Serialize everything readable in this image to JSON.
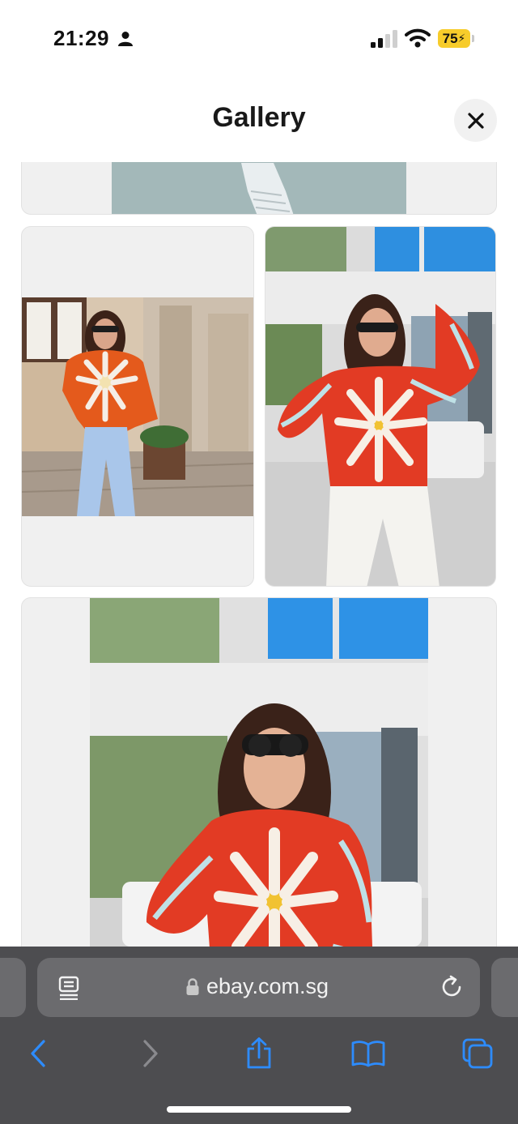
{
  "status_bar": {
    "time": "21:29",
    "battery_level": "75",
    "icons": [
      "person-icon",
      "signal-icon",
      "wifi-icon",
      "battery-icon"
    ]
  },
  "header": {
    "title": "Gallery",
    "close_icon": "close-icon"
  },
  "gallery": {
    "tiles": [
      {
        "id": "tile-top",
        "content": "photo-cropped"
      },
      {
        "id": "tile-left",
        "content": "photo"
      },
      {
        "id": "tile-right",
        "content": "photo"
      },
      {
        "id": "tile-big",
        "content": "photo"
      }
    ]
  },
  "browser": {
    "url": "ebay.com.sg",
    "icons": [
      "reader-icon",
      "lock-icon",
      "reload-icon",
      "back-icon",
      "forward-icon",
      "share-icon",
      "bookmarks-icon",
      "tabs-icon"
    ]
  },
  "colors": {
    "accent": "#2d8cff",
    "disabled": "#8a8a8e",
    "toolbar": "#4d4d50",
    "address_bar": "#6b6b6e",
    "battery": "#f7cc2b",
    "sweater_red": "#e23b24",
    "sweater_blue": "#bfe1e6",
    "jeans": "#a9c6ea"
  }
}
